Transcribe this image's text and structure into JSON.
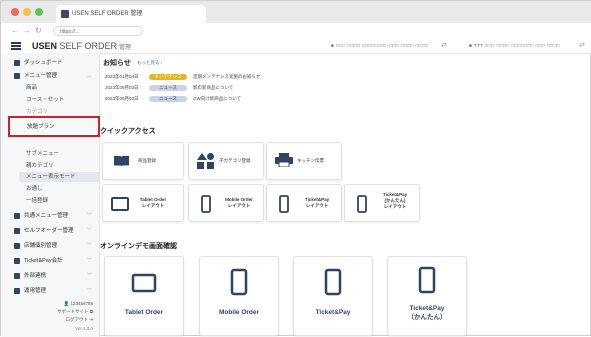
{
  "browser": {
    "tab_title": "USEN SELF ORDER 管理",
    "url": "https://..."
  },
  "header": {
    "brand_bold": "USEN",
    "brand_light": " SELF ORDER",
    "brand_suffix": "管理",
    "ticker_left": "■ □□□ □□□□ □□□□□□□□ □□□ □□□□ □□□□",
    "ticker_right": "■ TTT □□□ □□□□ □□□□□□□ □□□ □□□□"
  },
  "sidebar": {
    "dashboard": "ダッシュボード",
    "menu_manage": "メニュー管理",
    "sub_items": [
      "商品",
      "コース・セット",
      "カテゴリ"
    ],
    "highlighted": "放題プラン",
    "sub_items2": [
      "サブメニュー",
      "親カテゴリ",
      "メニュー表示モード",
      "お通し",
      "一括登録"
    ],
    "groups": [
      "共通メニュー管理",
      "セルフオーダー管理",
      "店舗個別管理",
      "Ticket&Pay会計",
      "外部連携",
      "運用管理"
    ],
    "footer": [
      "123456789",
      "サポートサイト",
      "ログアウト",
      "Ver.1.0.0"
    ]
  },
  "news": {
    "title": "お知らせ",
    "more": "もっと見る ›",
    "rows": [
      {
        "date": "2023年01月04日",
        "badge": "メンテナンス",
        "type": "maint",
        "text": "定期メンテナンス実施のお知らせ"
      },
      {
        "date": "2023年09月03日",
        "badge": "ニュース",
        "type": "news",
        "text": "新の新商品について"
      },
      {
        "date": "2023年09月03日",
        "badge": "ニュース",
        "type": "news",
        "text": "GW向け新商品について"
      }
    ]
  },
  "quick_access": {
    "title": "クイックアクセス",
    "row1": [
      "商品登録",
      "子カテゴリ登録",
      "キッチン伝票"
    ],
    "row2": [
      "Tablet Order\nレイアウト",
      "Mobile Order\nレイアウト",
      "Ticket&Pay\nレイアウト",
      "Ticket&Pay\n(かんたん)\nレイアウト"
    ]
  },
  "demo": {
    "title": "オンラインデモ画面確認",
    "cards": [
      "Tablet Order",
      "Mobile Order",
      "Ticket&Pay",
      "Ticket&Pay\n（かんたん）"
    ]
  },
  "colors": {
    "navy": "#2f4566",
    "highlight_red": "#c8232c",
    "maint_badge": "#e3b52b",
    "news_badge": "#c9d3e3"
  }
}
